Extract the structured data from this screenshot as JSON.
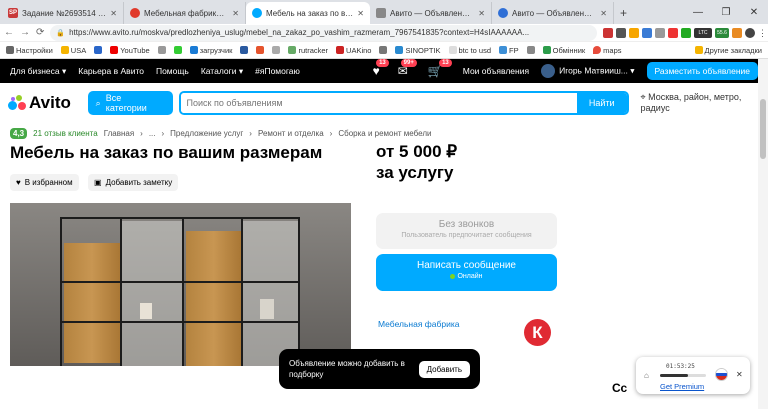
{
  "browser": {
    "tabs": [
      {
        "label": "Задание №2693514 - просмо",
        "color": "#c93a3a",
        "fav": "SP"
      },
      {
        "label": "Мебельная фабрика Комфор",
        "color": "#e0392b",
        "fav": ""
      },
      {
        "label": "Мебель на заказ по вашим р",
        "color": "#00aaff",
        "fav": "",
        "active": true
      },
      {
        "label": "Авито — Объявления на сайт",
        "color": "#888888",
        "fav": ""
      },
      {
        "label": "Авито — Объявления на сайт",
        "color": "#2f6fd6",
        "fav": ""
      }
    ],
    "url": "https://www.avito.ru/moskva/predlozheniya_uslug/mebel_na_zakaz_po_vashim_razmeram_7967541835?context=H4sIAAAAAA...",
    "bookmarks": [
      "Настройки",
      "USA",
      "",
      "YouTube",
      "",
      "",
      "загрузчик",
      "",
      "",
      "",
      "rutracker",
      "UAKino",
      "",
      "SINOPTIK",
      "btc to usd",
      "FP",
      "",
      "Обмінник",
      "maps"
    ],
    "bookmarks_other": "Другие закладки",
    "ext_labels": {
      "ltc": "LTC",
      "ltc_val": "55.6",
      "mb": "28.0"
    }
  },
  "topbar": {
    "for_business": "Для бизнеса",
    "career": "Карьера в Авито",
    "help": "Помощь",
    "catalogs": "Каталоги",
    "hashtag": "#яПомогаю",
    "badge_fav": "13",
    "badge_msg": "99+",
    "badge_cart": "13",
    "my_ads": "Мои объявления",
    "user": "Игорь Матвииш...",
    "place_ad": "Разместить объявление"
  },
  "search": {
    "logo": "Avito",
    "categories": "Все категории",
    "placeholder": "Поиск по объявлениям",
    "button": "Найти",
    "location": "Москва, район, метро, радиус"
  },
  "breadcrumbs": {
    "rating": "4,3",
    "reviews": "21 отзыв клиента",
    "items": [
      "Главная",
      "...",
      "Предложение услуг",
      "Ремонт и отделка",
      "Сборка и ремонт мебели"
    ]
  },
  "listing": {
    "title": "Мебель на заказ по вашим размерам",
    "price_line1": "от 5 000 ₽",
    "price_line2": "за услугу",
    "fav_btn": "В избранном",
    "note_btn": "Добавить заметку",
    "no_calls": "Без звонков",
    "no_calls_sub": "Пользователь предпочитает сообщения",
    "write_msg": "Написать сообщение",
    "online": "Онлайн",
    "seller": "Мебельная фабрика",
    "seller_logo": "К"
  },
  "toast": {
    "text": "Объявление можно добавить в подборку",
    "button": "Добавить"
  },
  "vpn": {
    "time": "01:53:25",
    "premium": "Get Premium"
  },
  "side_fragment": "Сс"
}
